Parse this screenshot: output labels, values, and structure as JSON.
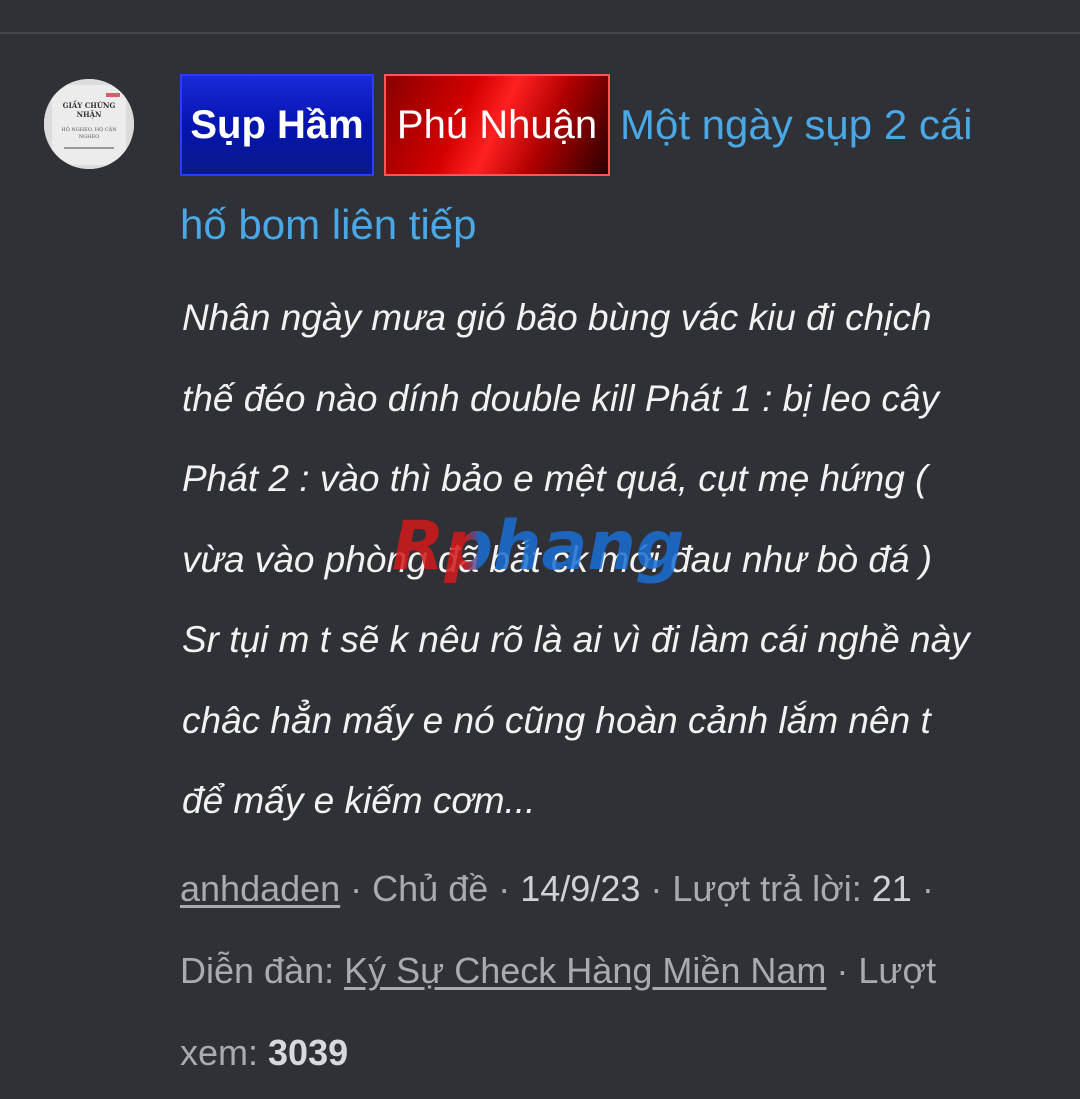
{
  "thread": {
    "prefix_1": "Sụp Hầm",
    "prefix_2": "Phú Nhuận",
    "title_part1": "Một ngày sụp 2 cái",
    "title_part2": "hố bom liên tiếp",
    "snippet_lines": [
      "Nhân ngày mưa gió bão bùng vác kiu đi chịch",
      "thế đéo nào dính double kill Phát 1 : bị leo cây",
      "Phát 2 : vào thì bảo e mệt quá, cụt mẹ hứng (",
      "vừa vào phòng đã bắt ck mới đau như bò đá )",
      "Sr tụi m t sẽ k nêu rõ là ai vì đi làm cái nghề này",
      "châc hẳn mấy e nó cũng hoàn cảnh lắm nên t",
      "để mấy e kiếm cơm..."
    ],
    "meta": {
      "author": "anhdaden",
      "sep": " · ",
      "type": "Chủ đề",
      "date": "14/9/23",
      "replies_label": "Lượt trả lời:",
      "replies": "21",
      "forum_label": "Diễn đàn:",
      "forum": "Ký Sự Check Hàng Miền Nam",
      "views_label_a": "Lượt",
      "views_label_b": "xem:",
      "views": "3039"
    }
  },
  "avatar": {
    "line1": "GIẤY CHỨNG",
    "line2": "NHẬN",
    "line3": "HỘ NGHÈO, HỘ CẬN",
    "line4": "NGHÈO"
  },
  "watermark": {
    "text": "Rphang"
  },
  "colors": {
    "background": "#2f3136",
    "title_link": "#4aa8e6",
    "meta_text": "#a9abb0"
  }
}
